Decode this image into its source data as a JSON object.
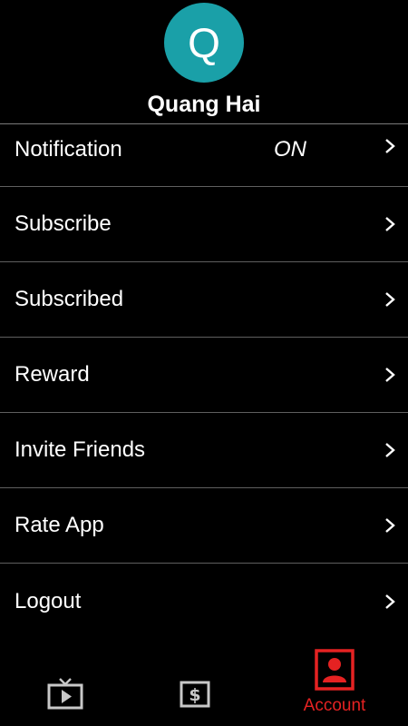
{
  "profile": {
    "initial": "Q",
    "name": "Quang Hai",
    "avatar_color": "#1aa0a8"
  },
  "menu": {
    "items": [
      {
        "label": "Notification",
        "value": "ON",
        "icon": "chevron-right-icon"
      },
      {
        "label": "Subscribe",
        "icon": "chevron-right-icon"
      },
      {
        "label": "Subscribed",
        "icon": "chevron-right-icon"
      },
      {
        "label": "Reward",
        "icon": "chevron-right-icon"
      },
      {
        "label": "Invite Friends",
        "icon": "chevron-right-icon"
      },
      {
        "label": "Rate App",
        "icon": "chevron-right-icon"
      },
      {
        "label": "Logout",
        "icon": "chevron-right-icon"
      }
    ]
  },
  "tabbar": {
    "active_color": "#e52222",
    "inactive_color": "#c8c8c8",
    "tabs": [
      {
        "icon": "tv-play-icon",
        "label": ""
      },
      {
        "icon": "dollar-icon",
        "label": ""
      },
      {
        "icon": "account-icon",
        "label": "Account",
        "active": true
      }
    ]
  }
}
